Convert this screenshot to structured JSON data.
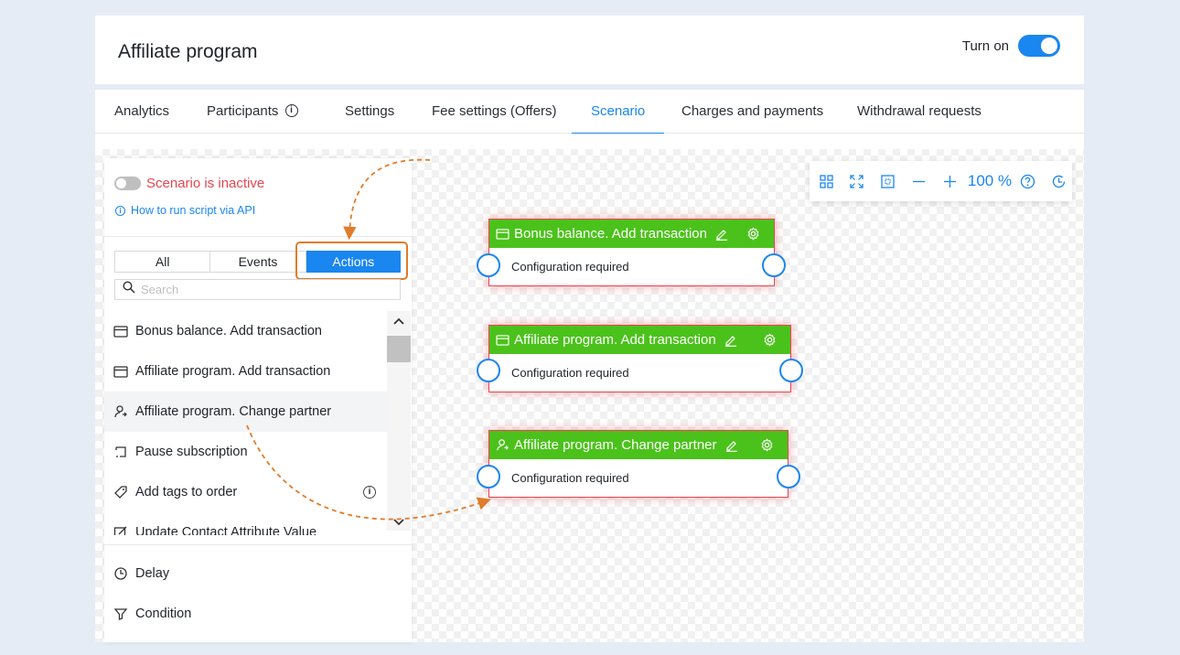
{
  "header": {
    "title": "Affiliate program",
    "turn_on_label": "Turn on",
    "turn_on_state": true
  },
  "tabs": [
    {
      "label": "Analytics"
    },
    {
      "label": "Participants"
    },
    {
      "label": "Settings"
    },
    {
      "label": "Fee settings (Offers)"
    },
    {
      "label": "Scenario",
      "active": true
    },
    {
      "label": "Charges and payments"
    },
    {
      "label": "Withdrawal requests"
    }
  ],
  "panel": {
    "status": "Scenario is inactive",
    "api_link": "How to run script via API",
    "filters": [
      "All",
      "Events",
      "Actions"
    ],
    "active_filter": "Actions",
    "search_placeholder": "Search",
    "items": [
      {
        "label": "Bonus balance. Add transaction",
        "icon": "card-icon"
      },
      {
        "label": "Affiliate program. Add transaction",
        "icon": "card-icon"
      },
      {
        "label": "Affiliate program. Change partner",
        "icon": "user-swap-icon"
      },
      {
        "label": "Pause subscription",
        "icon": "pause-subscription-icon"
      },
      {
        "label": "Add tags to order",
        "icon": "tag-icon"
      },
      {
        "label": "Update Contact Attribute Value",
        "icon": "edit-icon"
      }
    ],
    "bottom_items": [
      {
        "label": "Delay",
        "icon": "clock-icon"
      },
      {
        "label": "Condition",
        "icon": "filter-icon"
      }
    ]
  },
  "toolbar": {
    "zoom": "100 %"
  },
  "nodes": [
    {
      "title": "Bonus balance. Add transaction",
      "body": "Configuration required",
      "icon": "card-icon"
    },
    {
      "title": "Affiliate program. Add transaction",
      "body": "Configuration required",
      "icon": "card-icon"
    },
    {
      "title": "Affiliate program. Change partner",
      "body": "Configuration required",
      "icon": "user-swap-icon"
    }
  ],
  "colors": {
    "accent": "#1a86f0",
    "node_header": "#4bc21b",
    "error": "#e8454f",
    "annotation": "#e07c2a"
  }
}
